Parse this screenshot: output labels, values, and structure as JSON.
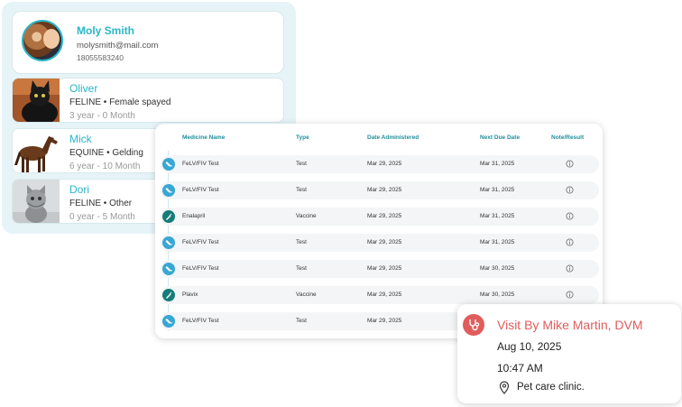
{
  "owner": {
    "name": "Moly Smith",
    "email": "molysmith@mail.com",
    "phone": "18055583240"
  },
  "pets": [
    {
      "name": "Oliver",
      "species": "FELINE",
      "detail": "Female spayed",
      "age": "3 year - 0 Month"
    },
    {
      "name": "Mick",
      "species": "EQUINE",
      "detail": "Gelding",
      "age": "6 year - 10 Month"
    },
    {
      "name": "Dori",
      "species": "FELINE",
      "detail": "Other",
      "age": "0 year - 5 Month"
    }
  ],
  "medicine_table": {
    "headers": {
      "medicine": "Medicine Name",
      "type": "Type",
      "date_administered": "Date Administered",
      "next_due": "Next Due Date",
      "note": "Note/Result"
    },
    "rows": [
      {
        "icon": "test-tube-icon",
        "medicine": "FeLV/FIV Test",
        "type": "Test",
        "administered": "Mar 29, 2025",
        "next_due": "Mar 31, 2025"
      },
      {
        "icon": "test-tube-icon",
        "medicine": "FeLV/FIV Test",
        "type": "Test",
        "administered": "Mar 29, 2025",
        "next_due": "Mar 31, 2025"
      },
      {
        "icon": "syringe-icon",
        "medicine": "Enalapril",
        "type": "Vaccine",
        "administered": "Mar 29, 2025",
        "next_due": "Mar 31, 2025"
      },
      {
        "icon": "test-tube-icon",
        "medicine": "FeLV/FIV Test",
        "type": "Test",
        "administered": "Mar 29, 2025",
        "next_due": "Mar 31, 2025"
      },
      {
        "icon": "test-tube-icon",
        "medicine": "FeLV/FIV Test",
        "type": "Test",
        "administered": "Mar 29, 2025",
        "next_due": "Mar 30, 2025"
      },
      {
        "icon": "syringe-icon",
        "medicine": "Plavix",
        "type": "Vaccine",
        "administered": "Mar 29, 2025",
        "next_due": "Mar 30, 2025"
      },
      {
        "icon": "test-tube-icon",
        "medicine": "FeLV/FIV Test",
        "type": "Test",
        "administered": "Mar 29, 2025",
        "next_due": ""
      }
    ]
  },
  "visit": {
    "title": "Visit By Mike Martin, DVM",
    "date": "Aug 10, 2025",
    "time": "10:47 AM",
    "location": "Pet care clinic.",
    "icon": "stethoscope-icon"
  },
  "colors": {
    "accent": "#2bb6c9",
    "header_text": "#1f8e9c",
    "test_icon": "#38a7d4",
    "vaccine_icon": "#167c79",
    "visit_accent": "#e15c5c"
  }
}
